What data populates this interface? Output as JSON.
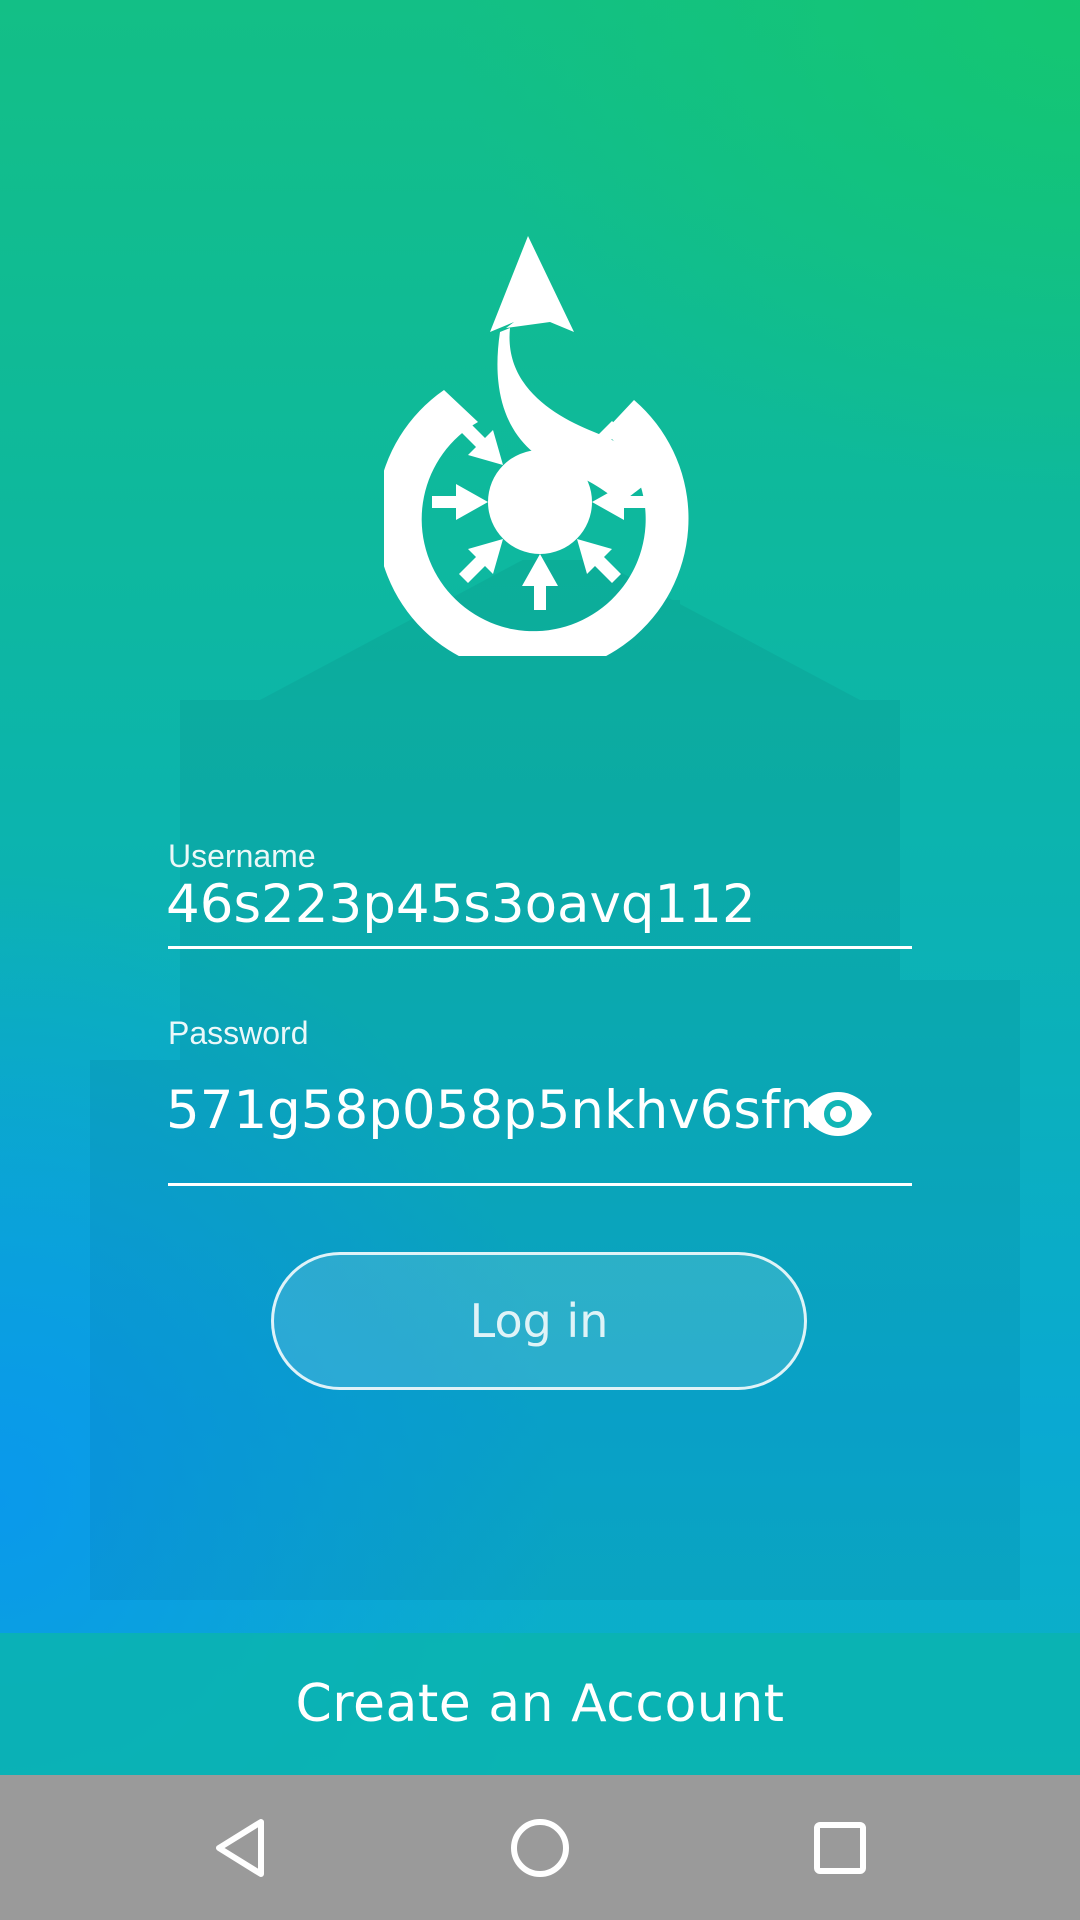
{
  "login": {
    "username_label": "Username",
    "username_value": "46s223p45s3oavq112",
    "password_label": "Password",
    "password_value": "571g58p058p5nkhv6sfn",
    "login_button": "Log in",
    "create_account": "Create an Account"
  },
  "icons": {
    "logo": "wikimedia-commons-logo",
    "password_toggle": "eye-icon",
    "nav_back": "back-triangle-icon",
    "nav_home": "home-circle-icon",
    "nav_recents": "recents-square-icon"
  },
  "colors": {
    "gradient_top": "#13bf86",
    "gradient_bottom": "#0aa9d2",
    "navbar": "#9a9a9a",
    "text": "#ffffff"
  }
}
